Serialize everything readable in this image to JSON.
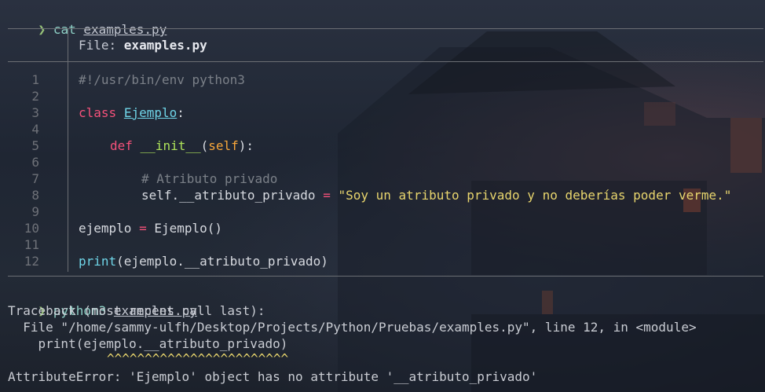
{
  "prompt_symbol": "❯",
  "commands": [
    {
      "cmd": "cat",
      "arg": "examples.py"
    },
    {
      "cmd": "python3",
      "arg": "examples.py"
    }
  ],
  "file_header": {
    "label": "File: ",
    "filename": "examples.py"
  },
  "code_lines": {
    "numbers": [
      "1",
      "2",
      "3",
      "4",
      "5",
      "6",
      "7",
      "8",
      "9",
      "10",
      "11",
      "12"
    ],
    "l1": "#!/usr/bin/env python3",
    "l3_kw": "class",
    "l3_name": "Ejemplo",
    "l3_end": ":",
    "l5_kw": "def",
    "l5_name": "__init__",
    "l5_open": "(",
    "l5_self": "self",
    "l5_end": "):",
    "l7": "# Atributo privado",
    "l8_lhs": "self.__atributo_privado",
    "l8_op": "=",
    "l8_str": "\"Soy un atributo privado y no deberías poder verme.\"",
    "l10_lhs": "ejemplo",
    "l10_op": "=",
    "l10_rhs": "Ejemplo()",
    "l12_fn": "print",
    "l12_rest": "(ejemplo.__atributo_privado)"
  },
  "output": {
    "traceback": "Traceback (most recent call last):",
    "file_line": "  File \"/home/sammy-ulfh/Desktop/Projects/Python/Pruebas/examples.py\", line 12, in <module>",
    "code_line": "    print(ejemplo.__atributo_privado)",
    "carets": "^^^^^^^^^^^^^^^^^^^^^^^^",
    "error": "AttributeError: 'Ejemplo' object has no attribute '__atributo_privado'"
  }
}
